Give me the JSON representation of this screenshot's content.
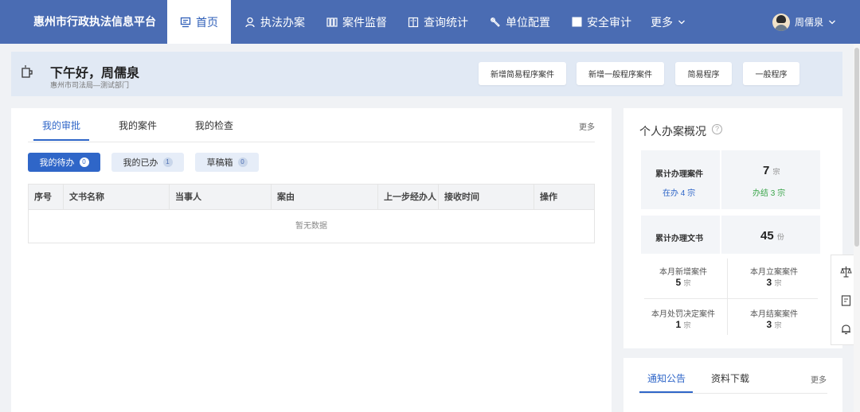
{
  "nav": {
    "brand": "惠州市行政执法信息平台",
    "items": [
      {
        "label": "首页",
        "icon": "home-icon"
      },
      {
        "label": "执法办案",
        "icon": "person-icon"
      },
      {
        "label": "案件监督",
        "icon": "columns-icon"
      },
      {
        "label": "查询统计",
        "icon": "book-icon"
      },
      {
        "label": "单位配置",
        "icon": "wrench-icon"
      },
      {
        "label": "安全审计",
        "icon": "square-icon"
      },
      {
        "label": "更多",
        "icon": "chevron-down-icon"
      }
    ],
    "user_name": "周儒泉"
  },
  "greeting": {
    "title": "下午好，周儒泉",
    "subtitle": "惠州市司法局—测试部门",
    "buttons": [
      "新增简易程序案件",
      "新增一般程序案件",
      "简易程序",
      "一般程序"
    ]
  },
  "work": {
    "tabs": [
      "我的审批",
      "我的案件",
      "我的检查"
    ],
    "more": "更多",
    "filters": [
      {
        "label": "我的待办",
        "count": "0"
      },
      {
        "label": "我的已办",
        "count": "1"
      },
      {
        "label": "草稿箱",
        "count": "0"
      }
    ],
    "columns": [
      "序号",
      "文书名称",
      "当事人",
      "案由",
      "上一步经办人",
      "接收时间",
      "操作"
    ],
    "empty_text": "暂无数据"
  },
  "overview": {
    "title": "个人办案概况",
    "help_icon": "?",
    "total_cases_label": "累计办理案件",
    "total_cases_value": "7",
    "unit_case": "宗",
    "in_progress": "在办 4 宗",
    "closed": "办结 3 宗",
    "total_docs_label": "累计办理文书",
    "total_docs_value": "45",
    "unit_doc": "份",
    "monthly": [
      {
        "label": "本月新增案件",
        "value": "5"
      },
      {
        "label": "本月立案案件",
        "value": "3"
      },
      {
        "label": "本月处罚决定案件",
        "value": "1"
      },
      {
        "label": "本月结案案件",
        "value": "3"
      }
    ]
  },
  "notice": {
    "tabs": [
      "通知公告",
      "资料下载"
    ],
    "more": "更多"
  },
  "colors": {
    "nav_bg": "#4a6cb3",
    "accent": "#2f66c8",
    "success": "#3aa54a"
  }
}
